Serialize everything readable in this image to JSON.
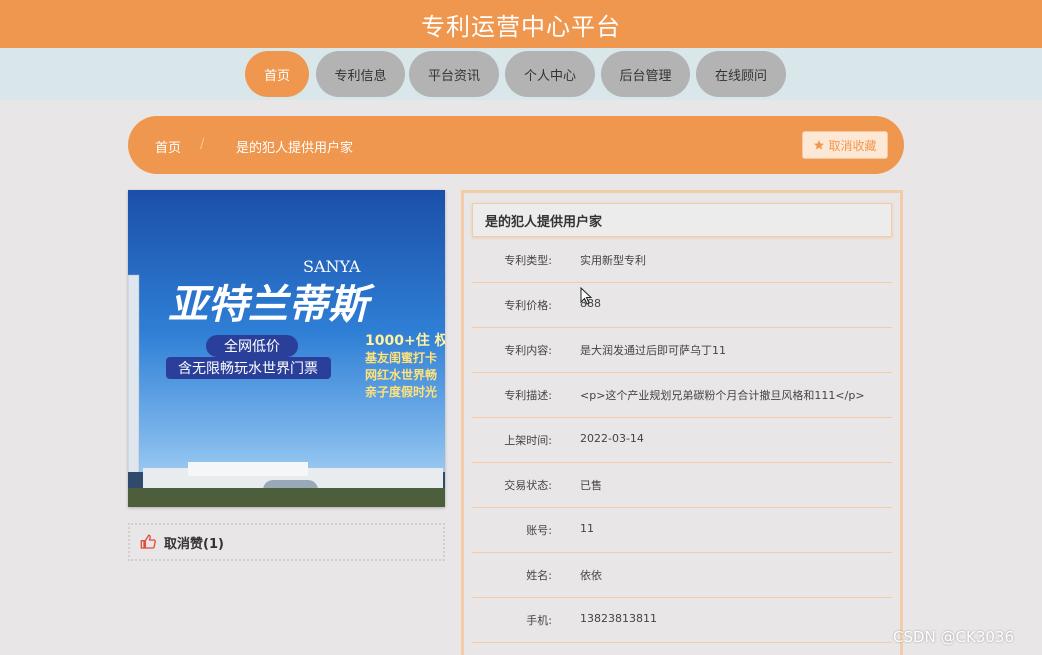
{
  "header": {
    "title": "专利运营中心平台"
  },
  "nav": {
    "items": [
      {
        "label": "首页",
        "active": true
      },
      {
        "label": "专利信息",
        "active": false
      },
      {
        "label": "平台资讯",
        "active": false
      },
      {
        "label": "个人中心",
        "active": false
      },
      {
        "label": "后台管理",
        "active": false
      },
      {
        "label": "在线顾问",
        "active": false
      }
    ]
  },
  "breadcrumb": {
    "home": "首页",
    "separator": "/",
    "current": "是的犯人提供用户家"
  },
  "favorite_button": {
    "label": "取消收藏",
    "icon": "star-icon"
  },
  "poster": {
    "text_en": "SANYA",
    "headline": "亚特兰蒂斯",
    "price_badge": "全网低价",
    "subline": "含无限畅玩水世界门票",
    "count_text": "1000+住 权",
    "features": [
      "基友闺蜜打卡",
      "网红水世界畅",
      "亲子度假时光"
    ]
  },
  "like": {
    "label": "取消赞(1)",
    "icon": "thumbs-up-icon"
  },
  "detail": {
    "title": "是的犯人提供用户家",
    "rows": [
      {
        "key": "专利类型:",
        "value": "实用新型专利"
      },
      {
        "key": "专利价格:",
        "value": "888"
      },
      {
        "key": "专利内容:",
        "value": "是大润发通过后即可萨乌丁11"
      },
      {
        "key": "专利描述:",
        "value": "<p>这个产业规划兄弟碳粉个月合计撤旦风格和111</p>"
      },
      {
        "key": "上架时间:",
        "value": "2022-03-14"
      },
      {
        "key": "交易状态:",
        "value": "已售"
      },
      {
        "key": "账号:",
        "value": "11"
      },
      {
        "key": "姓名:",
        "value": "依依"
      },
      {
        "key": "手机:",
        "value": "13823813811"
      }
    ]
  },
  "watermark": "CSDN @CK3036",
  "colors": {
    "accent": "#f0974f",
    "nav_bg": "#d9e6ea",
    "page_bg": "#e8e6e6",
    "inactive_tab": "#b3b3b3",
    "border": "#f3cba6"
  }
}
